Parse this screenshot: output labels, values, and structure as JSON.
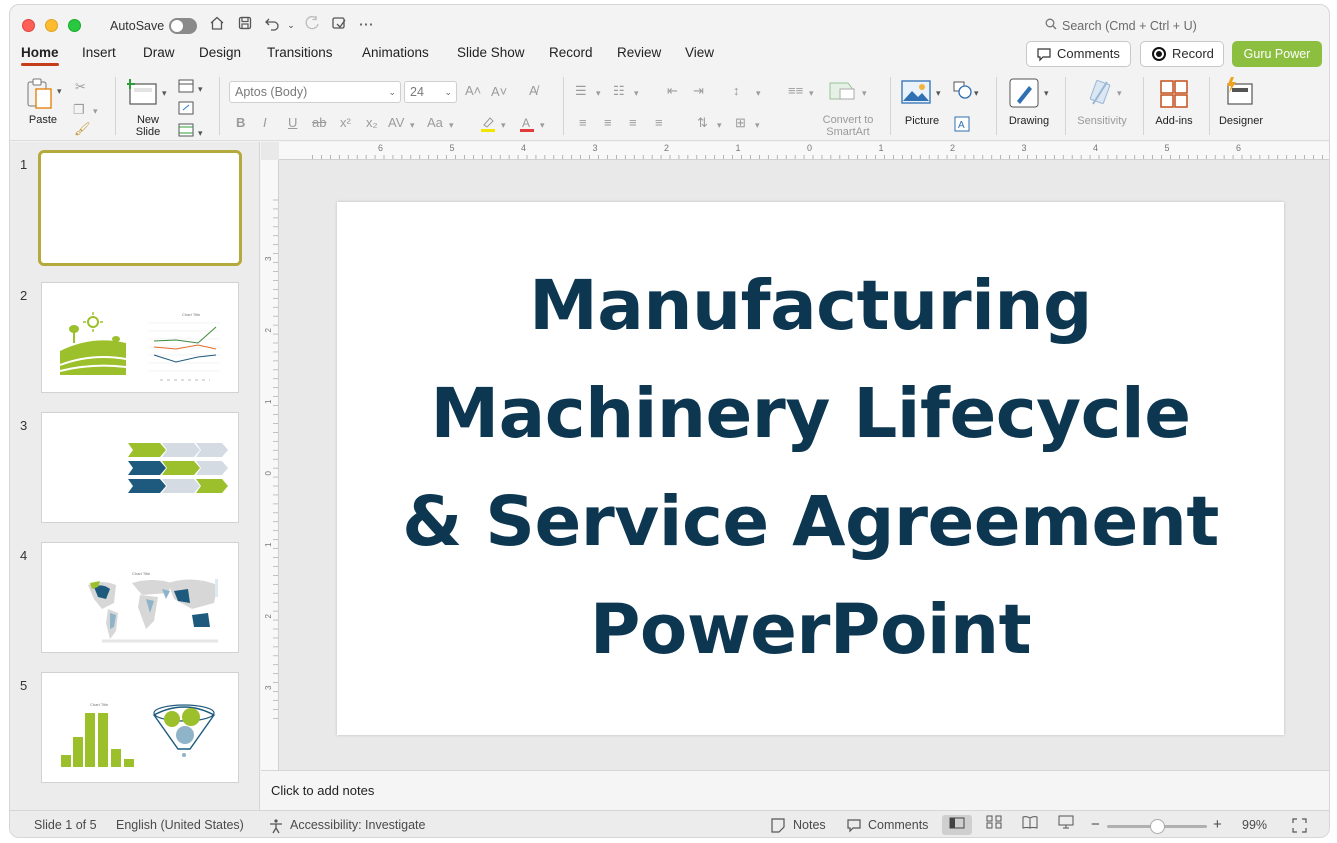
{
  "titlebar": {
    "autosave_label": "AutoSave",
    "search_placeholder": "Search (Cmd + Ctrl + U)"
  },
  "tabs": [
    "Home",
    "Insert",
    "Draw",
    "Design",
    "Transitions",
    "Animations",
    "Slide Show",
    "Record",
    "Review",
    "View"
  ],
  "actions": {
    "comments": "Comments",
    "record": "Record",
    "guru": "Guru Power"
  },
  "ribbon": {
    "paste": "Paste",
    "new_slide": [
      "New",
      "Slide"
    ],
    "font_name": "Aptos (Body)",
    "font_size": "24",
    "convert": [
      "Convert to",
      "SmartArt"
    ],
    "picture": "Picture",
    "drawing": "Drawing",
    "sensitivity": "Sensitivity",
    "addins": "Add-ins",
    "designer": "Designer"
  },
  "thumbnails": {
    "numbers": [
      "1",
      "2",
      "3",
      "4",
      "5"
    ],
    "chart_title_small": "Chart Title"
  },
  "slide": {
    "title_lines": [
      "Manufacturing",
      "Machinery Lifecycle",
      "& Service Agreement",
      "PowerPoint"
    ]
  },
  "notes": {
    "placeholder": "Click to add notes"
  },
  "status": {
    "slide_of": "Slide 1 of 5",
    "language": "English (United States)",
    "accessibility": "Accessibility: Investigate",
    "notes": "Notes",
    "comments": "Comments",
    "zoom": "99%"
  },
  "ruler": {
    "h_labels": [
      "6",
      "5",
      "4",
      "3",
      "2",
      "1",
      "0",
      "1",
      "2",
      "3",
      "4",
      "5",
      "6"
    ],
    "v_labels": [
      "3",
      "2",
      "1",
      "0",
      "1",
      "2",
      "3"
    ]
  },
  "colors": {
    "accent_tab": "#c43e1c",
    "guru_button": "#8cbf3f",
    "slide_title": "#0d3651",
    "selected_thumb_border": "#b5ab3d",
    "thumb_green": "#9cbf2c",
    "thumb_navy": "#1e5a7d"
  }
}
